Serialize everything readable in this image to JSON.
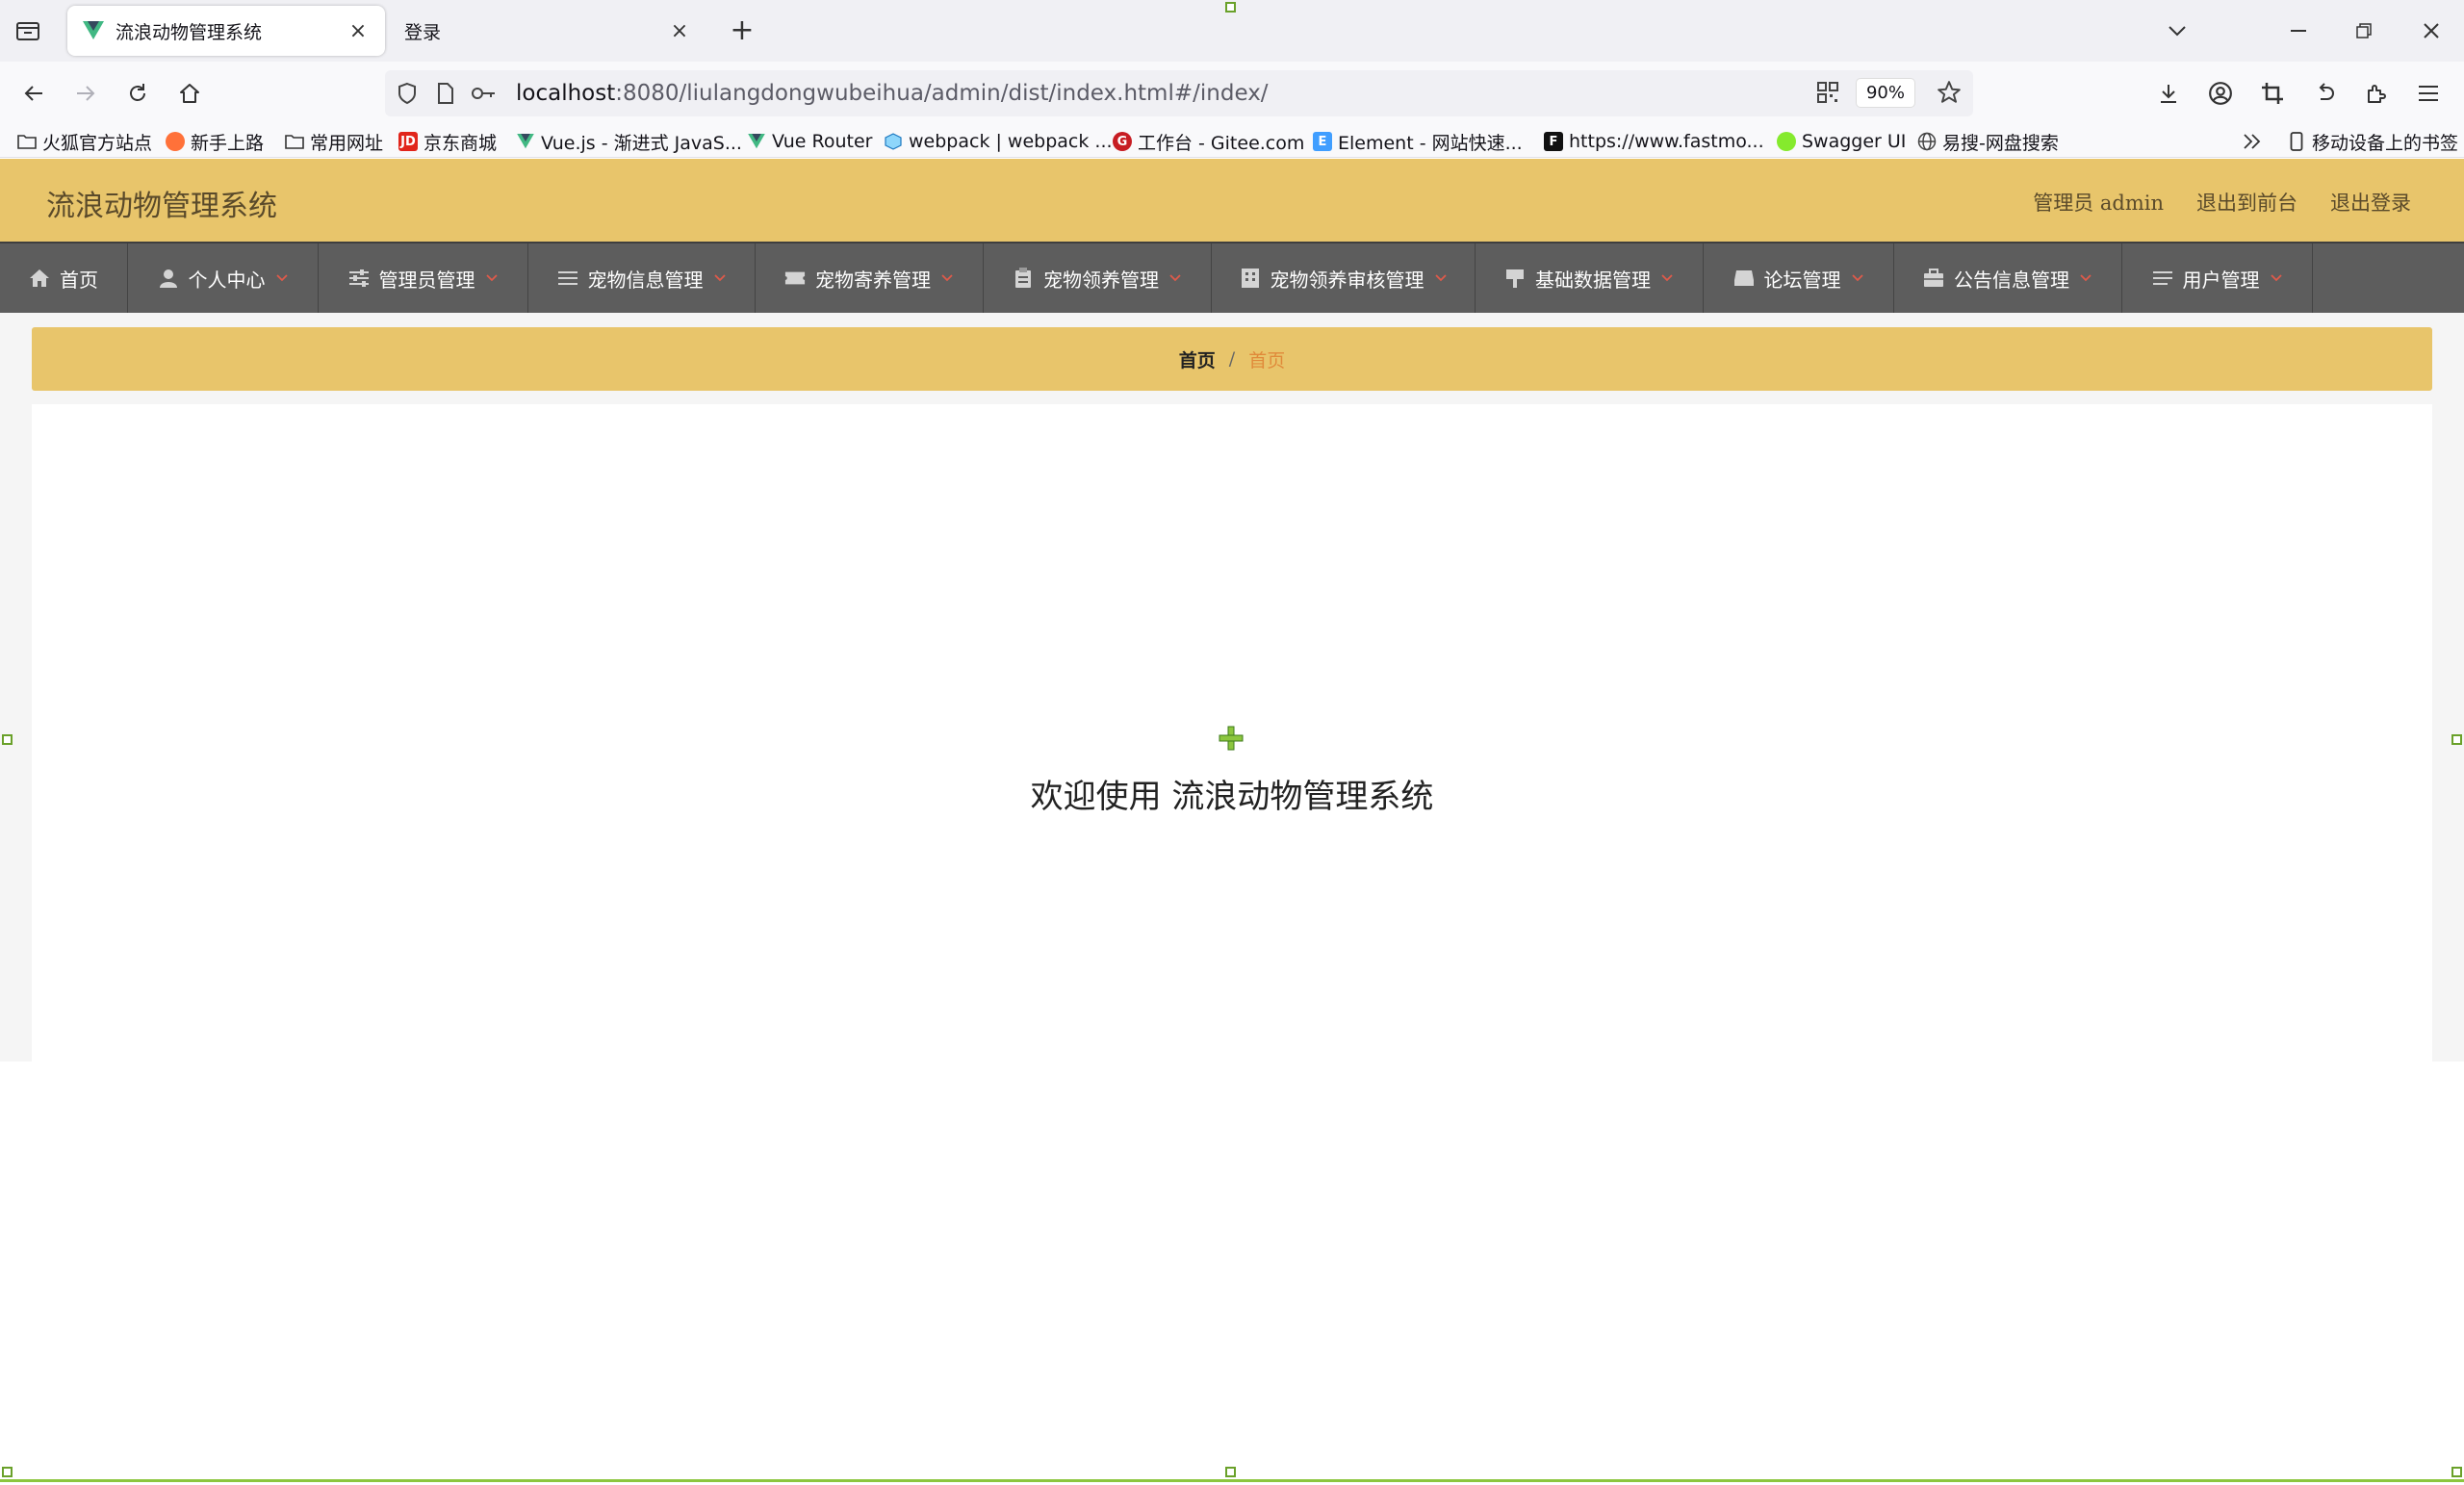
{
  "browser": {
    "tabs": [
      {
        "title": "流浪动物管理系统",
        "active": true,
        "favicon": "vue-icon"
      },
      {
        "title": "登录",
        "active": false
      }
    ],
    "url": {
      "host": "localhost",
      "rest": ":8080/liulangdongwubeihua/admin/dist/index.html#/index/"
    },
    "zoom": "90%",
    "bookmarks": [
      {
        "label": "火狐官方站点",
        "icon": "folder-icon"
      },
      {
        "label": "新手上路",
        "icon": "firefox-icon"
      },
      {
        "label": "常用网址",
        "icon": "folder-icon"
      },
      {
        "label": "京东商城",
        "icon": "jd-icon"
      },
      {
        "label": "Vue.js - 渐进式 JavaS...",
        "icon": "vue-icon"
      },
      {
        "label": "Vue Router",
        "icon": "vue-icon"
      },
      {
        "label": "webpack | webpack ...",
        "icon": "webpack-icon"
      },
      {
        "label": "工作台 - Gitee.com",
        "icon": "gitee-icon"
      },
      {
        "label": "Element - 网站快速...",
        "icon": "element-icon"
      },
      {
        "label": "https://www.fastmo...",
        "icon": "fastmock-icon"
      },
      {
        "label": "Swagger UI",
        "icon": "swagger-icon"
      },
      {
        "label": "易搜-网盘搜索",
        "icon": "globe-icon"
      }
    ],
    "mobile_bookmarks": "移动设备上的书签"
  },
  "app": {
    "title": "流浪动物管理系统",
    "header_links": [
      "管理员 admin",
      "退出到前台",
      "退出登录"
    ],
    "menu": [
      {
        "label": "首页",
        "icon": "home-icon",
        "has_dropdown": false
      },
      {
        "label": "个人中心",
        "icon": "user-icon",
        "has_dropdown": true
      },
      {
        "label": "管理员管理",
        "icon": "sliders-icon",
        "has_dropdown": true
      },
      {
        "label": "宠物信息管理",
        "icon": "list-icon",
        "has_dropdown": true
      },
      {
        "label": "宠物寄养管理",
        "icon": "ticket-icon",
        "has_dropdown": true
      },
      {
        "label": "宠物领养管理",
        "icon": "clipboard-icon",
        "has_dropdown": true
      },
      {
        "label": "宠物领养审核管理",
        "icon": "building-icon",
        "has_dropdown": true
      },
      {
        "label": "基础数据管理",
        "icon": "signpost-icon",
        "has_dropdown": true
      },
      {
        "label": "论坛管理",
        "icon": "inbox-icon",
        "has_dropdown": true
      },
      {
        "label": "公告信息管理",
        "icon": "briefcase-icon",
        "has_dropdown": true
      },
      {
        "label": "用户管理",
        "icon": "menu-lines-icon",
        "has_dropdown": true
      }
    ],
    "breadcrumb": {
      "home": "首页",
      "separator": "/",
      "current": "首页"
    },
    "welcome": "欢迎使用 流浪动物管理系统",
    "colors": {
      "header": "#e8c56b",
      "menu": "#5d5d5d",
      "caret": "#e05a4a",
      "breadcrumb_current": "#e08a3a"
    }
  }
}
